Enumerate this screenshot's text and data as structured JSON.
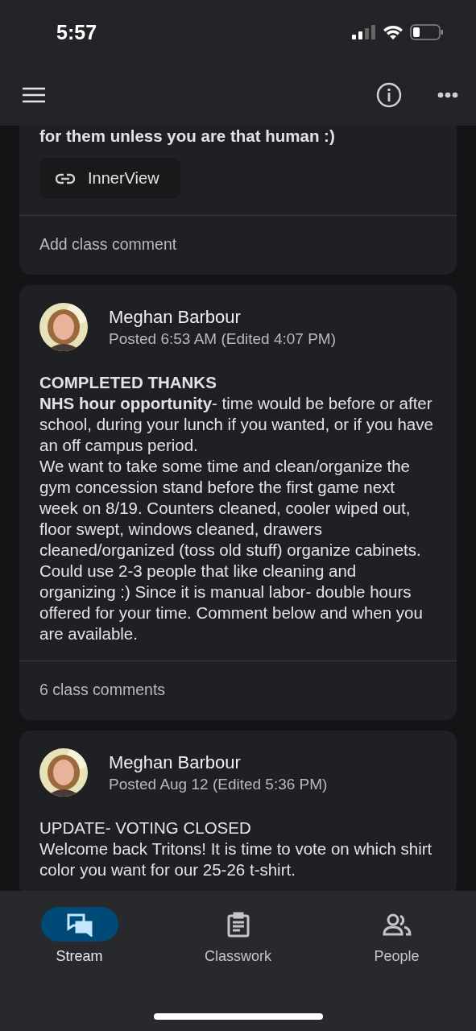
{
  "status_bar": {
    "time": "5:57"
  },
  "posts": [
    {
      "kind": "partial",
      "paragraphs": [
        {
          "kind": "heading",
          "text": "for them unless you are that human :)"
        }
      ],
      "attachment": {
        "label": "InnerView"
      },
      "comments": "Add class comment"
    },
    {
      "kind": "full",
      "author": "Meghan Barbour",
      "meta": "Posted 6:53 AM (Edited 4:07 PM)",
      "paragraphs": [
        {
          "kind": "heading",
          "text": "COMPLETED THANKS"
        },
        {
          "kind": "text",
          "text": "**NHS hour opportunity**- time would be before or after school, during your lunch if you wanted, or if you have an off campus period."
        },
        {
          "kind": "text",
          "text": "We want to take some time and clean/organize the gym concession stand before the first game next week on 8/19. Counters cleaned, cooler wiped out, floor swept, windows cleaned, drawers cleaned/organized (toss old stuff) organize cabinets."
        },
        {
          "kind": "text",
          "text": "Could use 2-3 people that like cleaning and organizing :) Since it is manual labor- double hours offered for your time. Comment below and when you are available."
        }
      ],
      "comments": "6 class comments"
    },
    {
      "kind": "full",
      "author": "Meghan Barbour",
      "meta": "Posted Aug 12 (Edited 5:36 PM)",
      "paragraphs": [
        {
          "kind": "text",
          "text": "UPDATE- VOTING CLOSED"
        },
        {
          "kind": "text",
          "text": "Welcome back Tritons! It is time to vote on which shirt color you want for our 25-26 t-shirt."
        }
      ]
    }
  ],
  "tabs": [
    {
      "label": "Stream",
      "selected": true
    },
    {
      "label": "Classwork",
      "selected": false
    },
    {
      "label": "People",
      "selected": false
    }
  ]
}
